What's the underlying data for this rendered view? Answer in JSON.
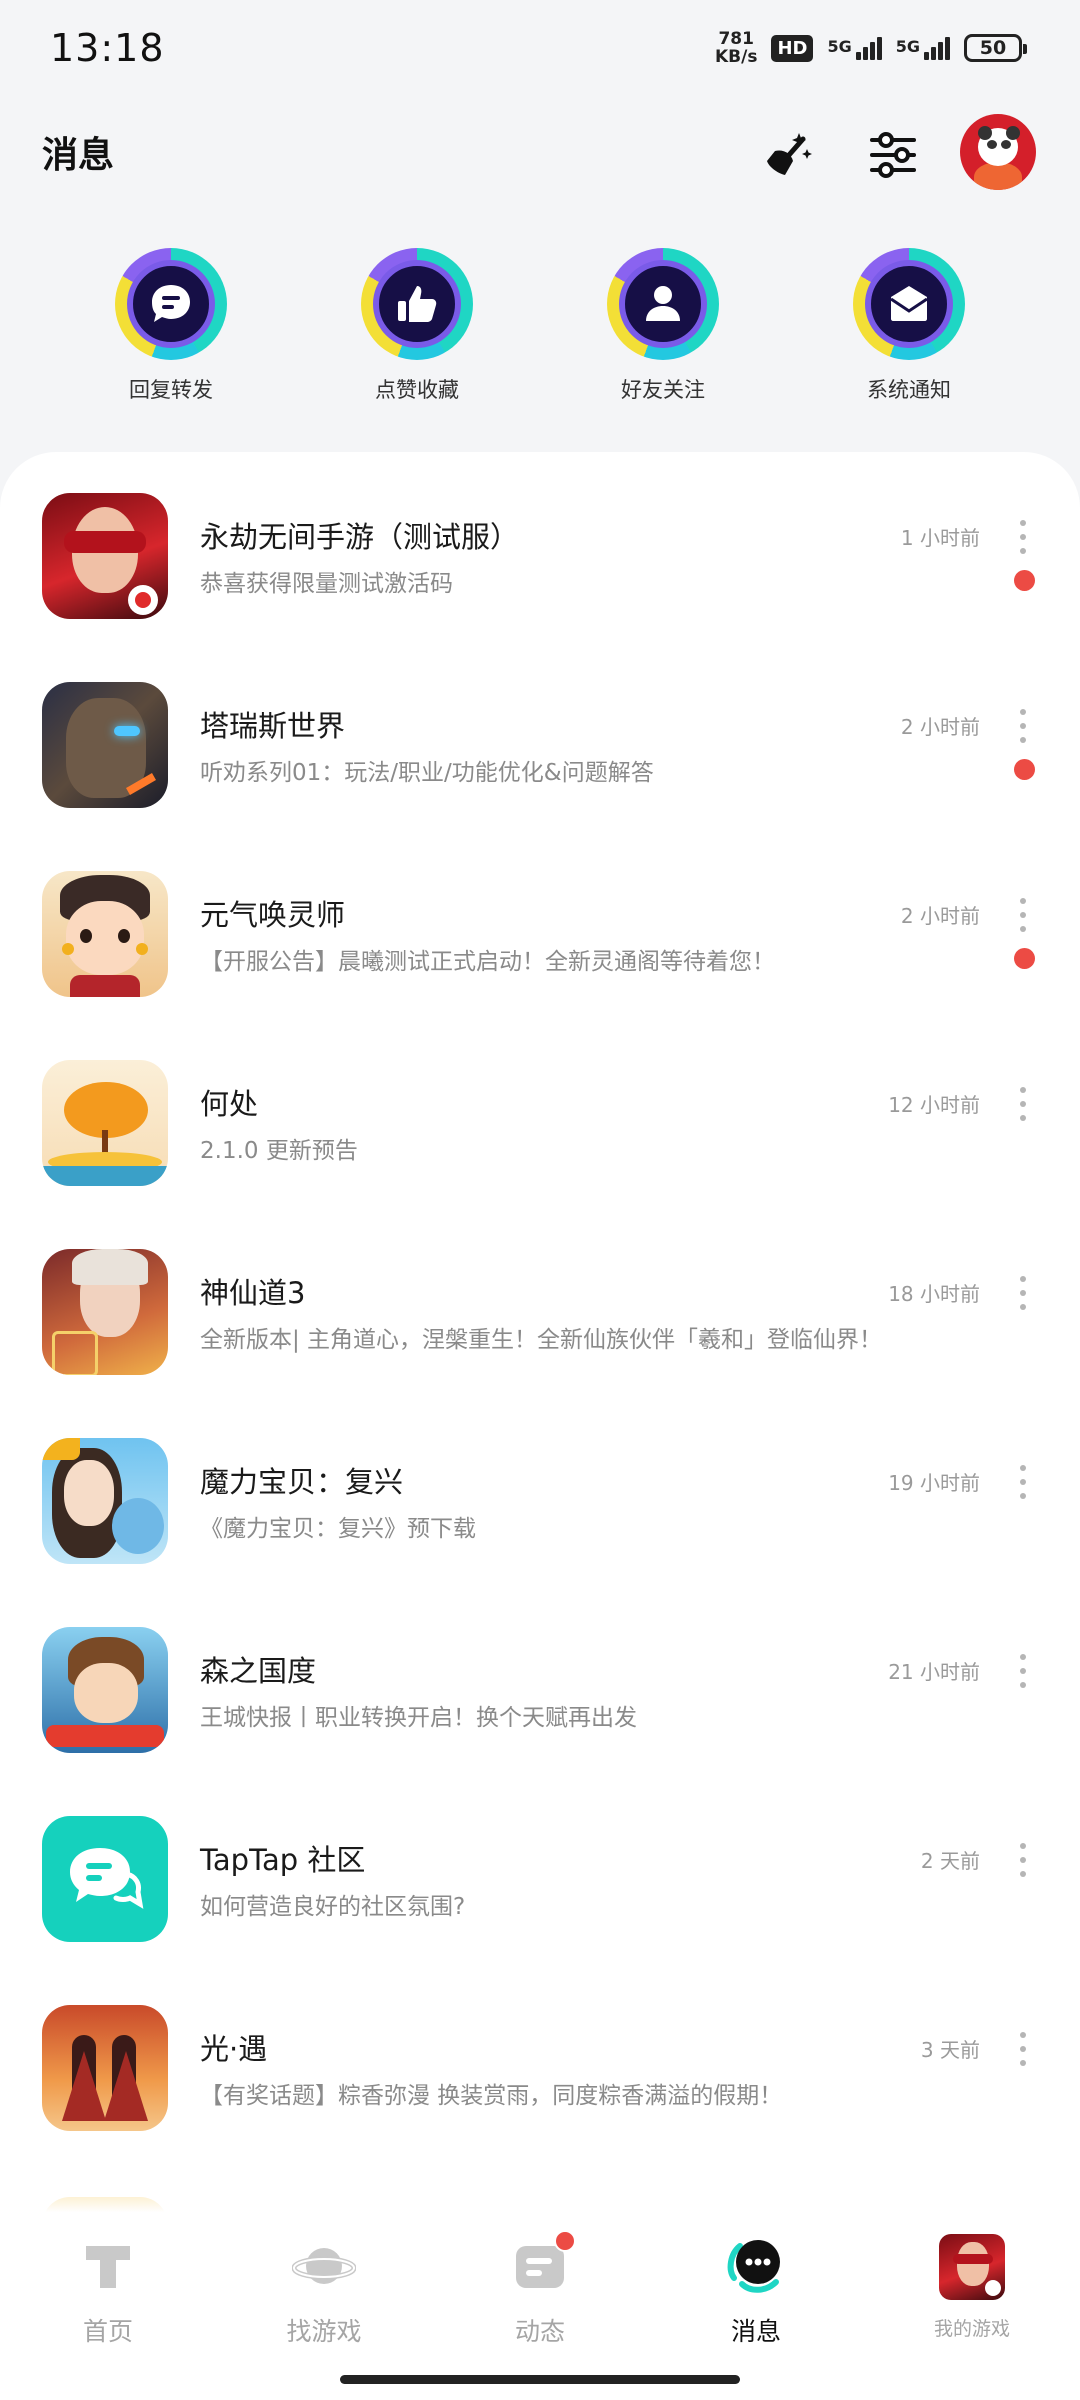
{
  "status_bar": {
    "time": "13:18",
    "speed_value": "781",
    "speed_unit": "KB/s",
    "hd": "HD",
    "network_1": "5G",
    "network_2": "5G",
    "battery": "50"
  },
  "header": {
    "title": "消息"
  },
  "categories": [
    {
      "label": "回复转发",
      "icon": "chat-bubble-icon"
    },
    {
      "label": "点赞收藏",
      "icon": "thumbs-up-icon"
    },
    {
      "label": "好友关注",
      "icon": "person-icon"
    },
    {
      "label": "系统通知",
      "icon": "envelope-icon"
    }
  ],
  "messages": [
    {
      "title": "永劫无间手游（测试服）",
      "subtitle": "恭喜获得限量测试激活码",
      "time": "1 小时前",
      "unread": true
    },
    {
      "title": "塔瑞斯世界",
      "subtitle": "听劝系列01：玩法/职业/功能优化&问题解答",
      "time": "2 小时前",
      "unread": true
    },
    {
      "title": "元气唤灵师",
      "subtitle": "【开服公告】晨曦测试正式启动！全新灵通阁等待着您！",
      "time": "2 小时前",
      "unread": true
    },
    {
      "title": "何处",
      "subtitle": "2.1.0 更新预告",
      "time": "12 小时前",
      "unread": false
    },
    {
      "title": "神仙道3",
      "subtitle": "全新版本| 主角道心，涅槃重生！全新仙族伙伴「羲和」登临仙界！",
      "time": "18 小时前",
      "unread": false
    },
    {
      "title": "魔力宝贝：复兴",
      "subtitle": "《魔力宝贝：复兴》预下载",
      "time": "19 小时前",
      "unread": false
    },
    {
      "title": "森之国度",
      "subtitle": "王城快报丨职业转换开启！换个天赋再出发",
      "time": "21 小时前",
      "unread": false
    },
    {
      "title": "TapTap 社区",
      "subtitle": "如何营造良好的社区氛围?",
      "time": "2 天前",
      "unread": false
    },
    {
      "title": "光·遇",
      "subtitle": "【有奖话题】粽香弥漫 换装赏雨，同度粽香满溢的假期！",
      "time": "3 天前",
      "unread": false
    }
  ],
  "bottom_nav": [
    {
      "label": "首页"
    },
    {
      "label": "找游戏"
    },
    {
      "label": "动态"
    },
    {
      "label": "消息"
    },
    {
      "label": "我的游戏"
    }
  ],
  "colors": {
    "accent": "#1fd6c4",
    "unread": "#ec4b44",
    "background": "#f4f5f7"
  }
}
